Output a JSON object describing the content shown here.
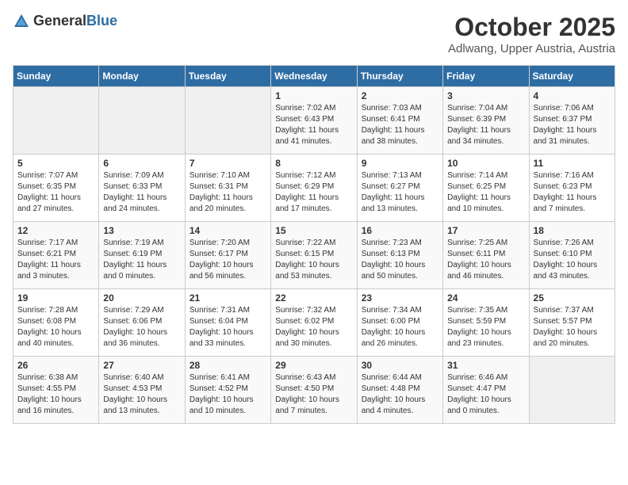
{
  "header": {
    "logo_general": "General",
    "logo_blue": "Blue",
    "month": "October 2025",
    "location": "Adlwang, Upper Austria, Austria"
  },
  "weekdays": [
    "Sunday",
    "Monday",
    "Tuesday",
    "Wednesday",
    "Thursday",
    "Friday",
    "Saturday"
  ],
  "weeks": [
    [
      {
        "day": "",
        "info": ""
      },
      {
        "day": "",
        "info": ""
      },
      {
        "day": "",
        "info": ""
      },
      {
        "day": "1",
        "info": "Sunrise: 7:02 AM\nSunset: 6:43 PM\nDaylight: 11 hours\nand 41 minutes."
      },
      {
        "day": "2",
        "info": "Sunrise: 7:03 AM\nSunset: 6:41 PM\nDaylight: 11 hours\nand 38 minutes."
      },
      {
        "day": "3",
        "info": "Sunrise: 7:04 AM\nSunset: 6:39 PM\nDaylight: 11 hours\nand 34 minutes."
      },
      {
        "day": "4",
        "info": "Sunrise: 7:06 AM\nSunset: 6:37 PM\nDaylight: 11 hours\nand 31 minutes."
      }
    ],
    [
      {
        "day": "5",
        "info": "Sunrise: 7:07 AM\nSunset: 6:35 PM\nDaylight: 11 hours\nand 27 minutes."
      },
      {
        "day": "6",
        "info": "Sunrise: 7:09 AM\nSunset: 6:33 PM\nDaylight: 11 hours\nand 24 minutes."
      },
      {
        "day": "7",
        "info": "Sunrise: 7:10 AM\nSunset: 6:31 PM\nDaylight: 11 hours\nand 20 minutes."
      },
      {
        "day": "8",
        "info": "Sunrise: 7:12 AM\nSunset: 6:29 PM\nDaylight: 11 hours\nand 17 minutes."
      },
      {
        "day": "9",
        "info": "Sunrise: 7:13 AM\nSunset: 6:27 PM\nDaylight: 11 hours\nand 13 minutes."
      },
      {
        "day": "10",
        "info": "Sunrise: 7:14 AM\nSunset: 6:25 PM\nDaylight: 11 hours\nand 10 minutes."
      },
      {
        "day": "11",
        "info": "Sunrise: 7:16 AM\nSunset: 6:23 PM\nDaylight: 11 hours\nand 7 minutes."
      }
    ],
    [
      {
        "day": "12",
        "info": "Sunrise: 7:17 AM\nSunset: 6:21 PM\nDaylight: 11 hours\nand 3 minutes."
      },
      {
        "day": "13",
        "info": "Sunrise: 7:19 AM\nSunset: 6:19 PM\nDaylight: 11 hours\nand 0 minutes."
      },
      {
        "day": "14",
        "info": "Sunrise: 7:20 AM\nSunset: 6:17 PM\nDaylight: 10 hours\nand 56 minutes."
      },
      {
        "day": "15",
        "info": "Sunrise: 7:22 AM\nSunset: 6:15 PM\nDaylight: 10 hours\nand 53 minutes."
      },
      {
        "day": "16",
        "info": "Sunrise: 7:23 AM\nSunset: 6:13 PM\nDaylight: 10 hours\nand 50 minutes."
      },
      {
        "day": "17",
        "info": "Sunrise: 7:25 AM\nSunset: 6:11 PM\nDaylight: 10 hours\nand 46 minutes."
      },
      {
        "day": "18",
        "info": "Sunrise: 7:26 AM\nSunset: 6:10 PM\nDaylight: 10 hours\nand 43 minutes."
      }
    ],
    [
      {
        "day": "19",
        "info": "Sunrise: 7:28 AM\nSunset: 6:08 PM\nDaylight: 10 hours\nand 40 minutes."
      },
      {
        "day": "20",
        "info": "Sunrise: 7:29 AM\nSunset: 6:06 PM\nDaylight: 10 hours\nand 36 minutes."
      },
      {
        "day": "21",
        "info": "Sunrise: 7:31 AM\nSunset: 6:04 PM\nDaylight: 10 hours\nand 33 minutes."
      },
      {
        "day": "22",
        "info": "Sunrise: 7:32 AM\nSunset: 6:02 PM\nDaylight: 10 hours\nand 30 minutes."
      },
      {
        "day": "23",
        "info": "Sunrise: 7:34 AM\nSunset: 6:00 PM\nDaylight: 10 hours\nand 26 minutes."
      },
      {
        "day": "24",
        "info": "Sunrise: 7:35 AM\nSunset: 5:59 PM\nDaylight: 10 hours\nand 23 minutes."
      },
      {
        "day": "25",
        "info": "Sunrise: 7:37 AM\nSunset: 5:57 PM\nDaylight: 10 hours\nand 20 minutes."
      }
    ],
    [
      {
        "day": "26",
        "info": "Sunrise: 6:38 AM\nSunset: 4:55 PM\nDaylight: 10 hours\nand 16 minutes."
      },
      {
        "day": "27",
        "info": "Sunrise: 6:40 AM\nSunset: 4:53 PM\nDaylight: 10 hours\nand 13 minutes."
      },
      {
        "day": "28",
        "info": "Sunrise: 6:41 AM\nSunset: 4:52 PM\nDaylight: 10 hours\nand 10 minutes."
      },
      {
        "day": "29",
        "info": "Sunrise: 6:43 AM\nSunset: 4:50 PM\nDaylight: 10 hours\nand 7 minutes."
      },
      {
        "day": "30",
        "info": "Sunrise: 6:44 AM\nSunset: 4:48 PM\nDaylight: 10 hours\nand 4 minutes."
      },
      {
        "day": "31",
        "info": "Sunrise: 6:46 AM\nSunset: 4:47 PM\nDaylight: 10 hours\nand 0 minutes."
      },
      {
        "day": "",
        "info": ""
      }
    ]
  ]
}
